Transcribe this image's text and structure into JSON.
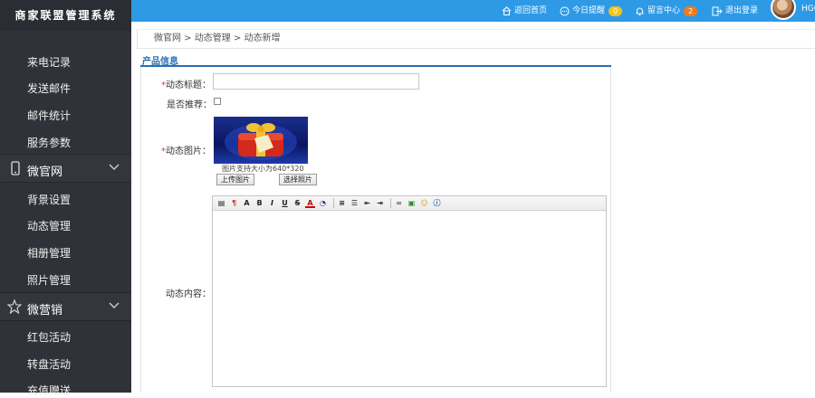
{
  "app": {
    "title": "商家联盟管理系统"
  },
  "sidebar": {
    "items_top": [
      {
        "label": "来电记录"
      },
      {
        "label": "发送邮件"
      },
      {
        "label": "邮件统计"
      },
      {
        "label": "服务参数"
      }
    ],
    "group1": {
      "label": "微官网",
      "icon": "phone-icon"
    },
    "items_group1": [
      {
        "label": "背景设置"
      },
      {
        "label": "动态管理"
      },
      {
        "label": "相册管理"
      },
      {
        "label": "照片管理"
      }
    ],
    "group2": {
      "label": "微营销",
      "icon": "star-icon"
    },
    "items_group2": [
      {
        "label": "红包活动"
      },
      {
        "label": "转盘活动"
      },
      {
        "label": "充值赠送"
      }
    ]
  },
  "topbar": {
    "home": "返回首页",
    "today": "今日提醒",
    "today_count": "0",
    "messages": "留言中心",
    "messages_count": "2",
    "logout": "退出登录",
    "user": "HGC"
  },
  "breadcrumb": "微官网 > 动态管理 > 动态新增",
  "panel": {
    "title": "产品信息",
    "fields": {
      "title_label": "动态标题：",
      "title_value": "",
      "recommend_label": "是否推荐：",
      "image_label": "动态图片：",
      "image_hint": "图片支持大小为640*320",
      "upload_btn": "上传图片",
      "select_btn": "选择照片",
      "content_label": "动态内容："
    },
    "required_mark": "*"
  },
  "colors": {
    "sidebar_bg": "#2f3238",
    "topbar_bg": "#2e9ae6",
    "accent": "#2a6db3",
    "badge_yellow": "#f0c419",
    "badge_orange": "#f07c1b"
  }
}
